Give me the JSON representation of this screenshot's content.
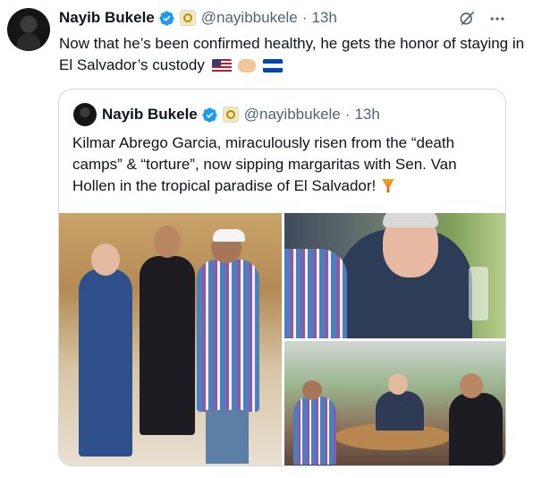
{
  "author": {
    "name": "Nayib Bukele",
    "handle": "@nayibbukele",
    "separator": "·",
    "time": "13h"
  },
  "tweet": {
    "text": "Now that he’s been confirmed healthy, he gets the honor of staying in El Salvador’s custody",
    "emoji": [
      "flag-us",
      "handshake",
      "flag-sv"
    ]
  },
  "quoted": {
    "name": "Nayib Bukele",
    "handle": "@nayibbukele",
    "separator": "·",
    "time": "13h",
    "text": "Kilmar Abrego Garcia, miraculously risen from the “death camps” & “torture”, now sipping margaritas with Sen. Van Hollen in the tropical paradise of El Salvador!",
    "emoji": "tropical-drink"
  },
  "icons": {
    "verified": "verified-badge-icon",
    "org": "government-affiliation-badge",
    "grok": "grok-icon",
    "more": "more-options-icon"
  },
  "colors": {
    "text": "#0f1419",
    "muted": "#536471",
    "verified": "#1d9bf0",
    "border": "#cfd9de"
  }
}
